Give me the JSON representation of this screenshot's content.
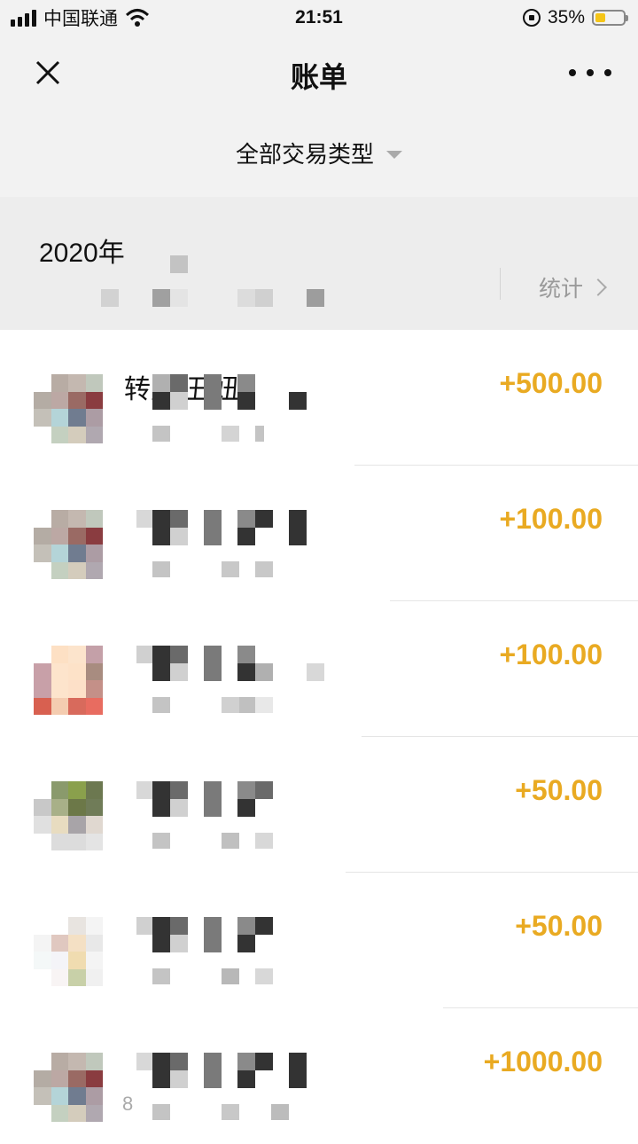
{
  "status_bar": {
    "carrier": "中国联通",
    "time": "21:51",
    "battery": "35%",
    "battery_level": 0.35,
    "icons": [
      "signal-icon",
      "wifi-icon",
      "rotation-lock-icon",
      "battery-icon"
    ]
  },
  "nav": {
    "title": "账单",
    "close_icon": "close-icon",
    "more_icon": "more-icon"
  },
  "filter": {
    "label": "全部交易类型",
    "icon": "caret-down-icon"
  },
  "month": {
    "title": "2020年",
    "stats_label": "统计",
    "stats_icon": "chevron-right-icon"
  },
  "transactions": [
    {
      "name": "转账-丑妞",
      "amount": "+500.00"
    },
    {
      "name": "",
      "amount": "+100.00"
    },
    {
      "name": "",
      "amount": "+100.00"
    },
    {
      "name": "",
      "amount": "+50.00"
    },
    {
      "name": "",
      "amount": "+50.00"
    },
    {
      "name": "",
      "amount": "+1000.00"
    }
  ],
  "footer_number": "8",
  "colors": {
    "amount": "#e9aa22",
    "header_bg": "#f2f2f2",
    "month_bg": "#ededed"
  }
}
